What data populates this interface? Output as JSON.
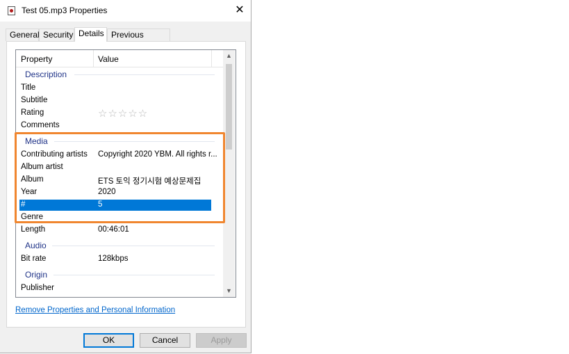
{
  "window": {
    "title": "Test 05.mp3 Properties",
    "close_glyph": "✕"
  },
  "tabs": [
    {
      "label": "General",
      "active": false
    },
    {
      "label": "Security",
      "active": false
    },
    {
      "label": "Details",
      "active": true
    },
    {
      "label": "Previous Versions",
      "active": false
    }
  ],
  "details": {
    "column_property": "Property",
    "column_value": "Value",
    "groups": {
      "description": "Description",
      "media": "Media",
      "audio": "Audio",
      "origin": "Origin"
    },
    "rows": {
      "title": {
        "label": "Title",
        "value": ""
      },
      "subtitle": {
        "label": "Subtitle",
        "value": ""
      },
      "rating": {
        "label": "Rating",
        "stars": "☆☆☆☆☆",
        "rating_value": 0
      },
      "comments": {
        "label": "Comments",
        "value": ""
      },
      "contributing_artists": {
        "label": "Contributing artists",
        "value": "Copyright 2020 YBM. All rights r..."
      },
      "album_artist": {
        "label": "Album artist",
        "value": ""
      },
      "album": {
        "label": "Album",
        "value": "ETS 토익 정기시험 예상문제집"
      },
      "year": {
        "label": "Year",
        "value": "2020"
      },
      "track": {
        "label": "#",
        "value": "5"
      },
      "genre": {
        "label": "Genre",
        "value": ""
      },
      "length": {
        "label": "Length",
        "value": "00:46:01"
      },
      "bit_rate": {
        "label": "Bit rate",
        "value": "128kbps"
      },
      "publisher": {
        "label": "Publisher",
        "value": ""
      }
    },
    "selected_row": "#",
    "highlight_color": "#f0862f"
  },
  "link": {
    "label": "Remove Properties and Personal Information"
  },
  "buttons": {
    "ok": "OK",
    "cancel": "Cancel",
    "apply": "Apply"
  },
  "colors": {
    "selection": "#0078d7",
    "group_header": "#1e3287",
    "link": "#0066cc"
  }
}
